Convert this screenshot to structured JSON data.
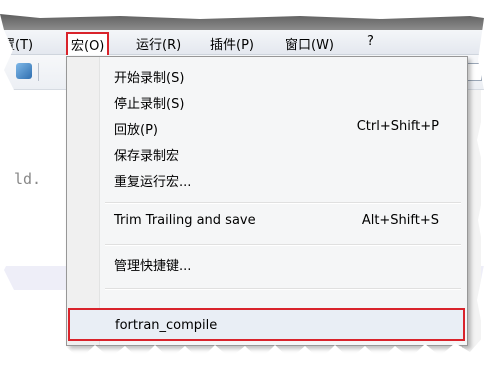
{
  "menubar": {
    "items": [
      {
        "label": "置(T)"
      },
      {
        "label": "宏(O)"
      },
      {
        "label": "运行(R)"
      },
      {
        "label": "插件(P)"
      },
      {
        "label": "窗口(W)"
      },
      {
        "label": "?"
      }
    ]
  },
  "editor": {
    "partial_text": "ld."
  },
  "macro_menu": {
    "items": [
      {
        "label": "开始录制(S)",
        "shortcut": ""
      },
      {
        "label": "停止录制(S)",
        "shortcut": ""
      },
      {
        "label": "回放(P)",
        "shortcut": "Ctrl+Shift+P"
      },
      {
        "label": "保存录制宏",
        "shortcut": ""
      },
      {
        "label": "重复运行宏...",
        "shortcut": ""
      },
      {
        "label": "Trim Trailing and save",
        "shortcut": "Alt+Shift+S"
      },
      {
        "label": "管理快捷键...",
        "shortcut": ""
      },
      {
        "label": "fortran_compile",
        "shortcut": ""
      }
    ]
  },
  "colors": {
    "highlight_border": "#d9232b",
    "menu_background": "#f5f6f7",
    "selected_row": "#e9eef5"
  }
}
